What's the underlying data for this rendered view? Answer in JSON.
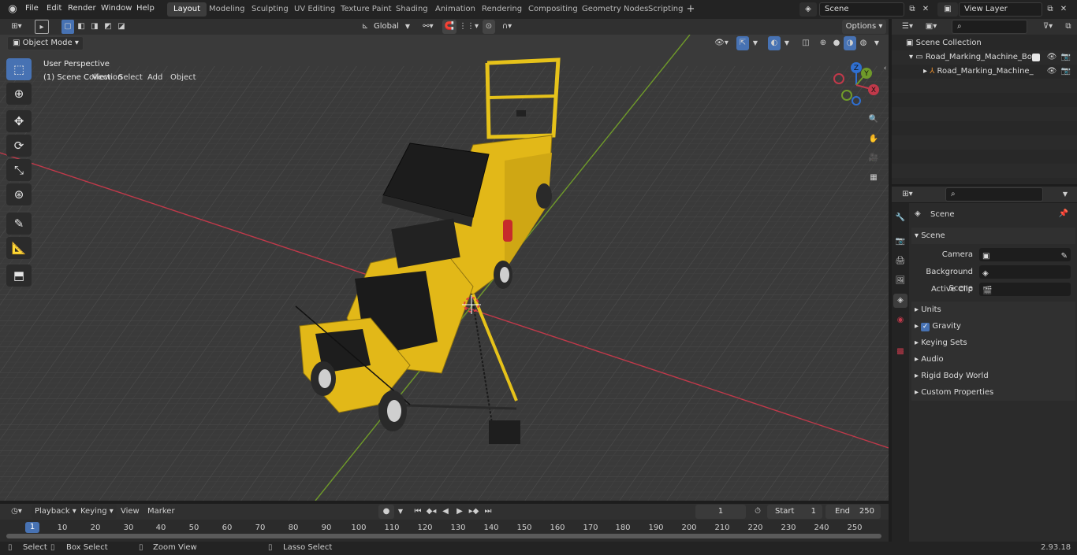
{
  "topbar": {
    "menus": [
      "File",
      "Edit",
      "Render",
      "Window",
      "Help"
    ],
    "workspaces": [
      "Layout",
      "Modeling",
      "Sculpting",
      "UV Editing",
      "Texture Paint",
      "Shading",
      "Animation",
      "Rendering",
      "Compositing",
      "Geometry Nodes",
      "Scripting"
    ],
    "active_workspace": "Layout",
    "scene_value": "Scene",
    "view_layer_value": "View Layer"
  },
  "viewport_header": {
    "mode": "Object Mode",
    "menus": [
      "View",
      "Select",
      "Add",
      "Object"
    ],
    "orientation": "Global",
    "options_label": "Options"
  },
  "viewport": {
    "overlay_line1": "User Perspective",
    "overlay_line2": "(1) Scene Collection",
    "gizmo_labels": {
      "z": "Z",
      "y": "Y",
      "x": "X"
    }
  },
  "outliner": {
    "root": "Scene Collection",
    "items": [
      {
        "label": "Road_Marking_Machine_Boru",
        "type": "collection"
      },
      {
        "label": "Road_Marking_Machine_",
        "type": "object"
      }
    ]
  },
  "properties": {
    "context": "Scene",
    "section": "Scene",
    "fields": [
      {
        "label": "Camera",
        "value": ""
      },
      {
        "label": "Background Scene",
        "value": ""
      },
      {
        "label": "Active Clip",
        "value": ""
      }
    ],
    "panels": [
      "Units",
      "Gravity",
      "Keying Sets",
      "Audio",
      "Rigid Body World",
      "Custom Properties"
    ],
    "gravity_checked": true
  },
  "timeline": {
    "menus": [
      "Playback",
      "Keying",
      "View",
      "Marker"
    ],
    "current_frame": "1",
    "start_label": "Start",
    "start_value": "1",
    "end_label": "End",
    "end_value": "250",
    "ruler": [
      "1",
      "10",
      "20",
      "30",
      "40",
      "50",
      "60",
      "70",
      "80",
      "90",
      "100",
      "110",
      "120",
      "130",
      "140",
      "150",
      "160",
      "170",
      "180",
      "190",
      "200",
      "210",
      "220",
      "230",
      "240",
      "250"
    ]
  },
  "statusbar": {
    "items": [
      "Select",
      "Box Select",
      "Zoom View",
      "Lasso Select"
    ],
    "version": "2.93.18"
  },
  "colors": {
    "accent": "#4772b3",
    "x_axis": "#c0394a",
    "y_axis": "#6f9a2a",
    "machine": "#e6c21a"
  }
}
